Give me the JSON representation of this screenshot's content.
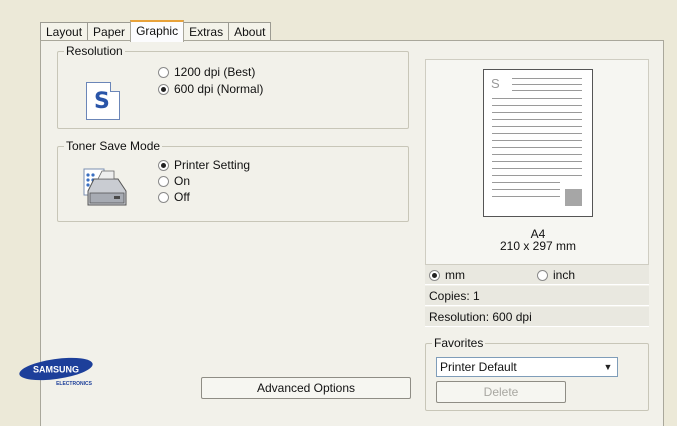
{
  "tabs": [
    {
      "label": "Layout"
    },
    {
      "label": "Paper"
    },
    {
      "label": "Graphic"
    },
    {
      "label": "Extras"
    },
    {
      "label": "About"
    }
  ],
  "resolution": {
    "title": "Resolution",
    "options": [
      {
        "label": "1200 dpi (Best)",
        "selected": false
      },
      {
        "label": "600 dpi (Normal)",
        "selected": true
      }
    ]
  },
  "toner": {
    "title": "Toner Save Mode",
    "options": [
      {
        "label": "Printer Setting",
        "selected": true
      },
      {
        "label": "On",
        "selected": false
      },
      {
        "label": "Off",
        "selected": false
      }
    ]
  },
  "preview": {
    "paper_size": "A4",
    "paper_dims": "210 x 297 mm",
    "paper_letter": "S"
  },
  "units": [
    {
      "label": "mm",
      "selected": true
    },
    {
      "label": "inch",
      "selected": false
    }
  ],
  "copies": "Copies: 1",
  "resolution_info": "Resolution: 600 dpi",
  "favorites": {
    "title": "Favorites",
    "selected": "Printer Default",
    "delete_label": "Delete"
  },
  "advanced_label": "Advanced Options",
  "logo": {
    "brand": "SAMSUNG",
    "sub": "ELECTRONICS"
  },
  "colors": {
    "dialog_bg": "#ece9d8",
    "page_bg": "#f2f1ea",
    "tab_accent": "#e8a23a",
    "logo_blue": "#1d3f9a"
  }
}
